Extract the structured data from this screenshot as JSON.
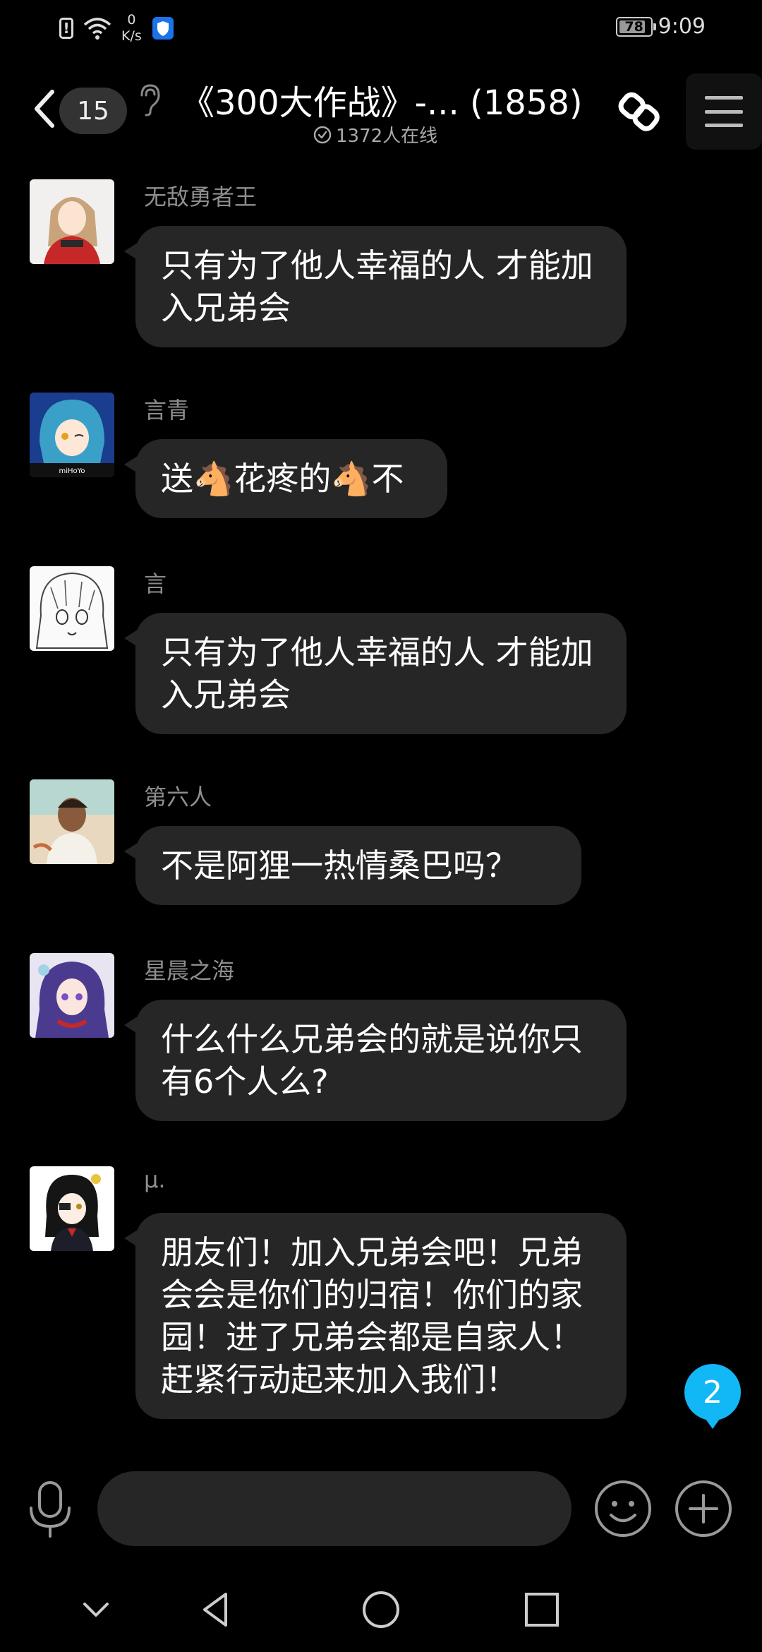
{
  "status_bar": {
    "net_speed_value": "0",
    "net_speed_unit": "K/s",
    "battery": "78",
    "time": "9:09"
  },
  "header": {
    "unread_count": "15",
    "title": "《300大作战》-...   (1858)",
    "online_text": "1372人在线"
  },
  "messages": [
    {
      "sender": "无敌勇者王",
      "text": "只有为了他人幸福的人 才能加入兄弟会",
      "avatar": "anime-girl-red-avatar"
    },
    {
      "sender": "言青",
      "text": "送🐴花疼的🐴不",
      "avatar": "blue-hair-girl-avatar"
    },
    {
      "sender": "言",
      "text": "只有为了他人幸福的人 才能加入兄弟会",
      "avatar": "manga-sketch-avatar"
    },
    {
      "sender": "第六人",
      "text": "不是阿狸一热情桑巴吗？",
      "avatar": "painted-boy-avatar"
    },
    {
      "sender": "星晨之海",
      "text": "什么什么兄弟会的就是说你只有6个人么?",
      "avatar": "purple-hair-avatar"
    },
    {
      "sender": "μ.",
      "text": "朋友们！加入兄弟会吧！兄弟会会是你们的归宿！你们的家园！进了兄弟会都是自家人！赶紧行动起来加入我们！",
      "avatar": "black-hair-girl-avatar"
    }
  ],
  "new_messages_badge": "2",
  "input": {
    "value": "",
    "placeholder": ""
  },
  "colors": {
    "background": "#000000",
    "bubble": "#262626",
    "sender": "#8e8e8e",
    "accent": "#12b7f5"
  },
  "icons": {
    "back": "chevron-left-icon",
    "ear": "ear-icon",
    "online": "check-circle-icon",
    "link": "link-icon",
    "menu": "menu-icon",
    "mic": "microphone-icon",
    "emoji": "smile-icon",
    "plus": "plus-circle-icon",
    "nav": [
      "chevron-down-icon",
      "back-triangle-icon",
      "home-circle-icon",
      "recents-square-icon"
    ]
  }
}
